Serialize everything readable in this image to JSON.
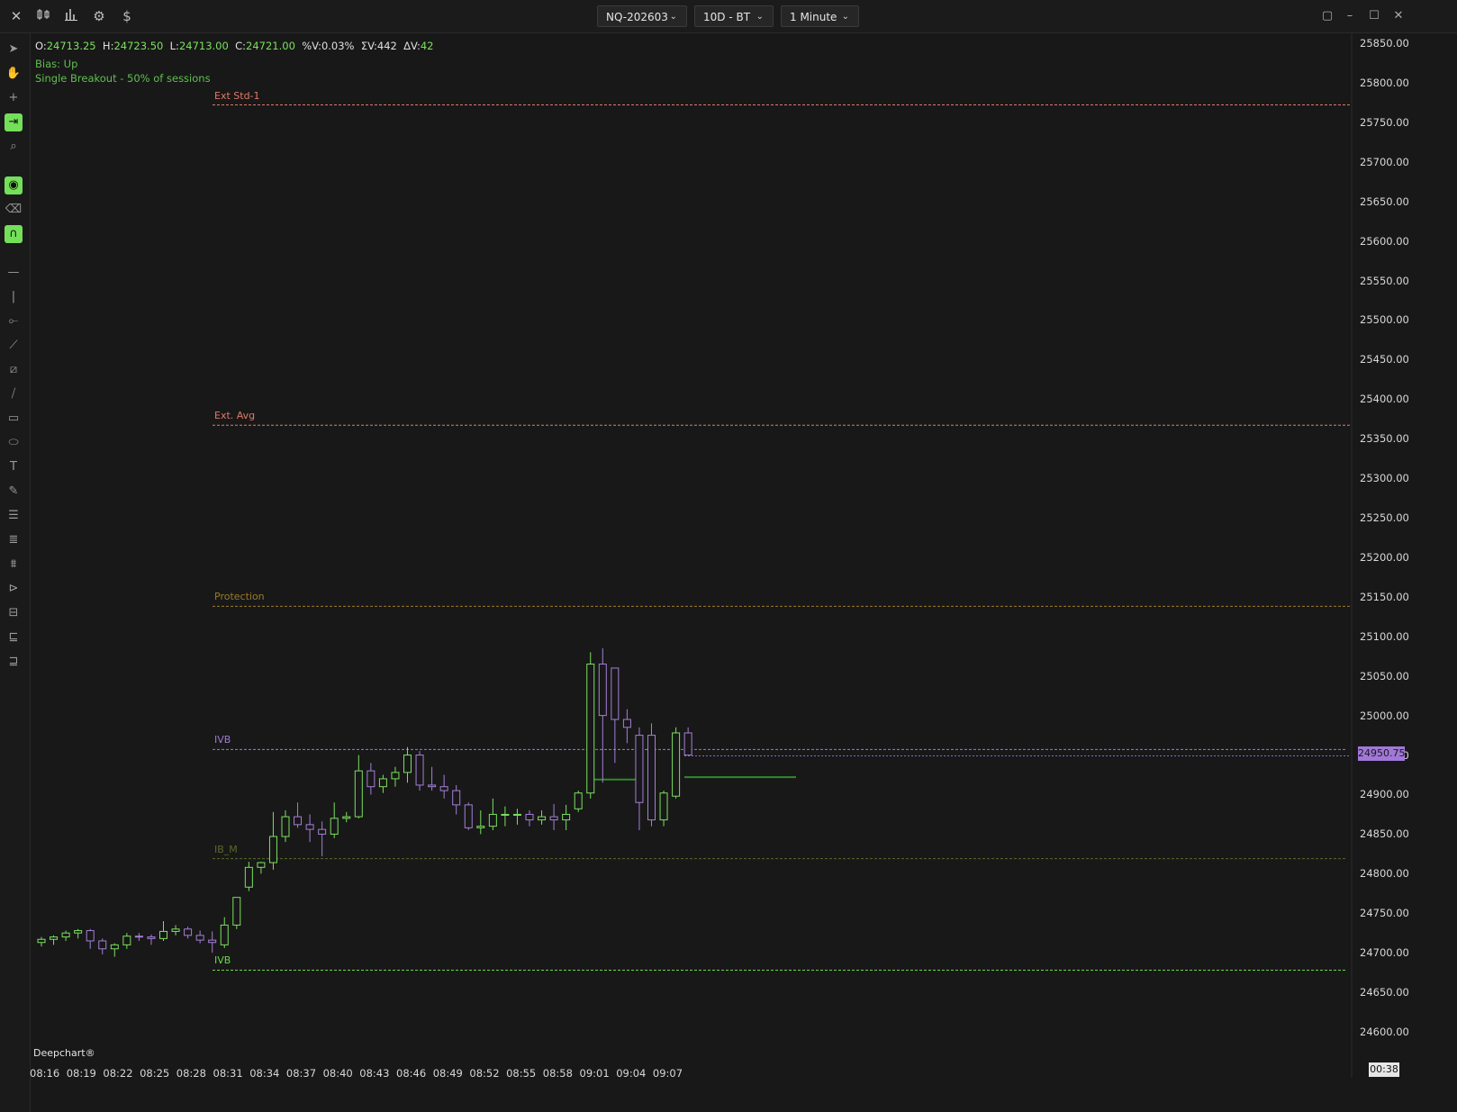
{
  "topbar": {
    "instrument": "NQ-202603",
    "range": "10D - BT",
    "timeframe": "1 Minute"
  },
  "ohlc": {
    "o_label": "O:",
    "o": "24713.25",
    "h_label": "H:",
    "h": "24723.50",
    "l_label": "L:",
    "l": "24713.00",
    "c_label": "C:",
    "c": "24721.00",
    "pv_label": "%V:",
    "pv": "0.03%",
    "sv_label": "ΣV:",
    "sv": "442",
    "dv_label": "ΔV:",
    "dv": "42"
  },
  "indicator": {
    "bias": "Bias: Up",
    "breakout": "Single Breakout - 50% of sessions"
  },
  "levels": [
    {
      "label": "Ext Std-1",
      "price": 25772,
      "color": "#e0796a"
    },
    {
      "label": "Ext. Avg",
      "price": 25367,
      "color": "#e0796a"
    },
    {
      "label": "Protection",
      "price": 25138,
      "color": "#9a7a2a"
    },
    {
      "label": "IVB",
      "price": 24957,
      "color": "#9b7cd0"
    },
    {
      "label": "IB_M",
      "price": 24819,
      "color": "#5a6a2a"
    },
    {
      "label": "IVB",
      "price": 24678,
      "color": "#6ad84a"
    }
  ],
  "brand": "Deepchart®",
  "current_price": "24950.75",
  "time_remaining": "00:38",
  "colors": {
    "up": "#7be05e",
    "down": "#a47fd8",
    "background": "#181818"
  },
  "chart_data": {
    "type": "candlestick",
    "x": [
      "08:16",
      "08:17",
      "08:18",
      "08:19",
      "08:20",
      "08:21",
      "08:22",
      "08:23",
      "08:24",
      "08:25",
      "08:26",
      "08:27",
      "08:28",
      "08:29",
      "08:30",
      "08:31",
      "08:32",
      "08:33",
      "08:34",
      "08:35",
      "08:36",
      "08:37",
      "08:38",
      "08:39",
      "08:40",
      "08:41",
      "08:42",
      "08:43",
      "08:44",
      "08:45",
      "08:46",
      "08:47",
      "08:48",
      "08:49",
      "08:50",
      "08:51",
      "08:52",
      "08:53",
      "08:54",
      "08:55",
      "08:56",
      "08:57",
      "08:58",
      "08:59",
      "09:00",
      "09:01",
      "09:02",
      "09:03",
      "09:04",
      "09:05",
      "09:06",
      "09:07",
      "09:08"
    ],
    "open": [
      24713,
      24717,
      24720,
      24725,
      24728,
      24715,
      24705,
      24710,
      24721,
      24720,
      24718,
      24727,
      24730,
      24722,
      24716,
      24710,
      24735,
      24783,
      24808,
      24814,
      24847,
      24872,
      24862,
      24856,
      24850,
      24870,
      24872,
      24930,
      24910,
      24920,
      24928,
      24950,
      24912,
      24910,
      24905,
      24887,
      24858,
      24860,
      24875,
      24875,
      24875,
      24868,
      24872,
      24868,
      24882,
      24902,
      25065,
      25060,
      24995,
      24975,
      24975,
      24868,
      24898,
      24978
    ],
    "high": [
      24720,
      24722,
      24728,
      24730,
      24730,
      24718,
      24712,
      24725,
      24725,
      24723,
      24740,
      24735,
      24733,
      24728,
      24727,
      24745,
      24760,
      24815,
      24815,
      24878,
      24880,
      24890,
      24875,
      24866,
      24890,
      24878,
      24950,
      24940,
      24925,
      24935,
      24960,
      24955,
      24935,
      24925,
      24912,
      24890,
      24880,
      24895,
      24885,
      24882,
      24880,
      24880,
      24888,
      24887,
      24905,
      25080,
      25085,
      25010,
      25008,
      24985,
      24990,
      24905,
      24985,
      24985
    ],
    "low": [
      24708,
      24710,
      24715,
      24718,
      24705,
      24698,
      24695,
      24705,
      24715,
      24710,
      24715,
      24722,
      24718,
      24712,
      24700,
      24706,
      24730,
      24778,
      24800,
      24805,
      24840,
      24858,
      24840,
      24822,
      24845,
      24865,
      24870,
      24900,
      24902,
      24910,
      24915,
      24905,
      24905,
      24895,
      24875,
      24855,
      24850,
      24855,
      24860,
      24862,
      24860,
      24862,
      24855,
      24855,
      24878,
      24895,
      24915,
      24940,
      24965,
      24855,
      24860,
      24860,
      24895,
      24950
    ],
    "close": [
      24717,
      24720,
      24725,
      24728,
      24715,
      24705,
      24710,
      24721,
      24720,
      24718,
      24727,
      24730,
      24722,
      24716,
      24713,
      24735,
      24770,
      24808,
      24814,
      24847,
      24872,
      24862,
      24856,
      24850,
      24870,
      24872,
      24930,
      24910,
      24920,
      24928,
      24950,
      24912,
      24910,
      24905,
      24887,
      24858,
      24860,
      24875,
      24875,
      24875,
      24868,
      24872,
      24868,
      24875,
      24902,
      25065,
      25000,
      24995,
      24985,
      24890,
      24868,
      24902,
      24978,
      24950
    ]
  },
  "axis": {
    "y_labels": [
      "25850.00",
      "25800.00",
      "25750.00",
      "25700.00",
      "25650.00",
      "25600.00",
      "25550.00",
      "25500.00",
      "25450.00",
      "25400.00",
      "25350.00",
      "25300.00",
      "25250.00",
      "25200.00",
      "25150.00",
      "25100.00",
      "25050.00",
      "25000.00",
      "24950.00",
      "24900.00",
      "24850.00",
      "24800.00",
      "24750.00",
      "24700.00",
      "24650.00",
      "24600.00"
    ],
    "x_labels": [
      "08:16",
      "08:19",
      "08:22",
      "08:25",
      "08:28",
      "08:31",
      "08:34",
      "08:37",
      "08:40",
      "08:43",
      "08:46",
      "08:49",
      "08:52",
      "08:55",
      "08:58",
      "09:01",
      "09:04",
      "09:07"
    ]
  }
}
